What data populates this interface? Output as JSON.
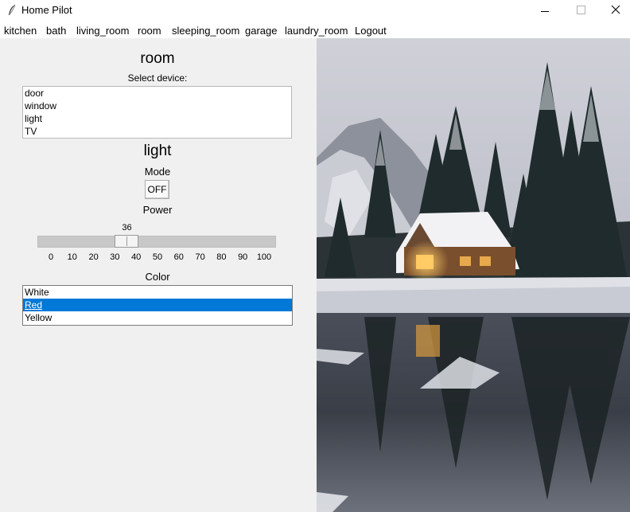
{
  "window": {
    "title": "Home Pilot"
  },
  "menu": [
    "kitchen",
    "bath",
    "living_room",
    "room",
    "sleeping_room",
    "garage",
    "laundry_room",
    "Logout"
  ],
  "room": {
    "title": "room",
    "select_label": "Select device:",
    "devices": [
      "door",
      "window",
      "light",
      "TV"
    ]
  },
  "device": {
    "title": "light",
    "mode_label": "Mode",
    "mode_button": "OFF",
    "power_label": "Power",
    "power_value": 36,
    "power_min": 0,
    "power_max": 100,
    "ticks": [
      "0",
      "10",
      "20",
      "30",
      "40",
      "50",
      "60",
      "70",
      "80",
      "90",
      "100"
    ],
    "color_label": "Color",
    "colors": [
      "White",
      "Red",
      "Yellow"
    ],
    "selected_color": "Red"
  },
  "theme": {
    "selection_color": "#0078d7",
    "panel_bg": "#f0f0f0"
  },
  "icons": {
    "app": "feather-icon",
    "minimize": "minimize-icon",
    "maximize": "maximize-icon",
    "close": "close-icon"
  }
}
